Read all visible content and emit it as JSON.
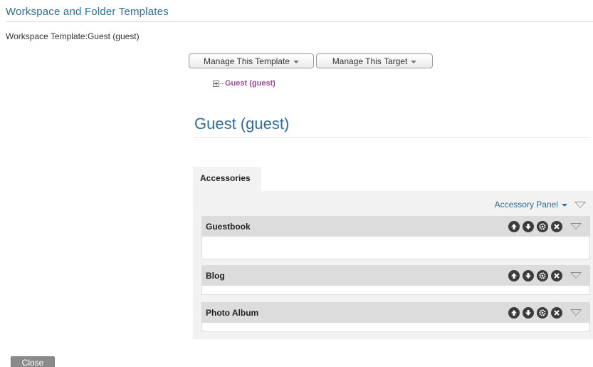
{
  "header": {
    "title": "Workspace and Folder Templates"
  },
  "template_line": "Workspace Template:Guest (guest)",
  "menus": {
    "manage_template": "Manage This Template",
    "manage_target": "Manage This Target"
  },
  "tree": {
    "node_label": "Guest (guest)"
  },
  "workspace": {
    "title": "Guest (guest)"
  },
  "tabs": [
    {
      "label": "Accessories",
      "selected": true
    }
  ],
  "panel": {
    "menu_label": "Accessory Panel",
    "accessories": [
      {
        "title": "Guestbook"
      },
      {
        "title": "Blog"
      },
      {
        "title": "Photo Album"
      }
    ],
    "controls": [
      "move-up-icon",
      "move-down-icon",
      "gear-icon",
      "remove-icon",
      "collapse-icon"
    ]
  },
  "footer": {
    "close_label": "Close"
  },
  "colors": {
    "link_blue": "#2d6d99",
    "tree_purple": "#9c4d9c",
    "panel_bg": "#f2f2f2",
    "accessory_header_bg": "#dcdcdc",
    "control_icon_bg": "#3c3c3c",
    "close_button_bg": "#8a8a8a"
  }
}
